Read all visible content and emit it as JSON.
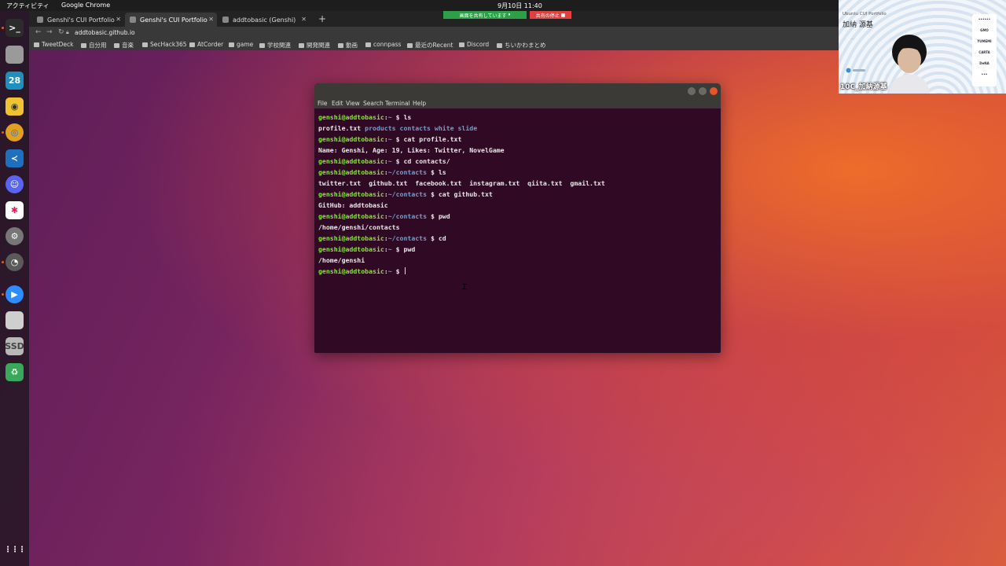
{
  "topbar": {
    "activities": "アクティビティ",
    "app_name": "Google Chrome",
    "clock": "9月10日 11:40"
  },
  "dock": {
    "items": [
      {
        "name": "terminal",
        "glyph": ">_",
        "color": "#2c2c2c",
        "fg": "#ffffff"
      },
      {
        "name": "files",
        "glyph": "",
        "color": "#9a9a9a",
        "fg": "#ffffff"
      },
      {
        "name": "calendar",
        "glyph": "28",
        "color": "#1e8fbf",
        "fg": "#ffffff"
      },
      {
        "name": "rhythmbox",
        "glyph": "◉",
        "color": "#f0c330",
        "fg": "#333333"
      },
      {
        "name": "chrome",
        "glyph": "◎",
        "color": "#e0a020",
        "fg": "#2a6fd6"
      },
      {
        "name": "vscode",
        "glyph": "≺",
        "color": "#1f6fbf",
        "fg": "#ffffff"
      },
      {
        "name": "discord",
        "glyph": "☺",
        "color": "#5865f2",
        "fg": "#ffffff"
      },
      {
        "name": "slack",
        "glyph": "✱",
        "color": "#ffffff",
        "fg": "#e01e5a"
      },
      {
        "name": "settings",
        "glyph": "⚙",
        "color": "#777777",
        "fg": "#ffffff"
      },
      {
        "name": "clock",
        "glyph": "◔",
        "color": "#5a5a5a",
        "fg": "#ffffff"
      },
      {
        "name": "zoom",
        "glyph": "▶",
        "color": "#2d8cff",
        "fg": "#ffffff"
      },
      {
        "name": "text-editor",
        "glyph": "",
        "color": "#cfcfcf",
        "fg": "#555555"
      },
      {
        "name": "ssd",
        "glyph": "SSD",
        "color": "#b8b8b8",
        "fg": "#444444"
      },
      {
        "name": "trash",
        "glyph": "♻",
        "color": "#3aa85a",
        "fg": "#ffffff"
      }
    ],
    "apps_grid": "⋮⋮⋮"
  },
  "browser": {
    "tabs": [
      {
        "title": "Genshi's CUI Portfolio",
        "active": false
      },
      {
        "title": "Genshi's CUI Portfolio",
        "active": true
      },
      {
        "title": "addtobasic (Genshi)",
        "active": false
      }
    ],
    "sharing": "画面を共有しています",
    "stop_sharing": "共有の停止",
    "url": "addtobasic.github.io",
    "bookmarks": [
      "TweetDeck",
      "自分用",
      "音楽",
      "SecHack365",
      "AtCorder",
      "game",
      "学校関連",
      "開発関連",
      "動画",
      "connpass",
      "最近のRecent",
      "Discord",
      "ちいかわまとめ"
    ]
  },
  "terminal": {
    "menu": [
      "File",
      "Edit",
      "View",
      "Search",
      "Terminal",
      "Help"
    ],
    "lines": [
      {
        "user": "genshi@addtobasic",
        "sep": ":",
        "path": "~",
        "cmd": " $ ls"
      },
      {
        "out": [
          {
            "t": "profile.txt ",
            "c": "plain"
          },
          {
            "t": "products ",
            "c": "dir"
          },
          {
            "t": "contacts ",
            "c": "dir"
          },
          {
            "t": "white ",
            "c": "dir"
          },
          {
            "t": "slide",
            "c": "dir"
          }
        ]
      },
      {
        "user": "genshi@addtobasic",
        "sep": ":",
        "path": "~",
        "cmd": " $ cat profile.txt"
      },
      {
        "out": [
          {
            "t": "Name: Genshi, Age: 19, Likes: Twitter, NovelGame",
            "c": "plain"
          }
        ]
      },
      {
        "user": "genshi@addtobasic",
        "sep": ":",
        "path": "~",
        "cmd": " $ cd contacts/"
      },
      {
        "user": "genshi@addtobasic",
        "sep": ":",
        "path": "~/contacts",
        "cmd": " $ ls"
      },
      {
        "out": [
          {
            "t": "twitter.txt  github.txt  facebook.txt  instagram.txt  qiita.txt  gmail.txt",
            "c": "plain"
          }
        ]
      },
      {
        "user": "genshi@addtobasic",
        "sep": ":",
        "path": "~/contacts",
        "cmd": " $ cat github.txt"
      },
      {
        "out": [
          {
            "t": "GitHub: addtobasic",
            "c": "plain"
          }
        ]
      },
      {
        "user": "genshi@addtobasic",
        "sep": ":",
        "path": "~/contacts",
        "cmd": " $ pwd"
      },
      {
        "out": [
          {
            "t": "/home/genshi/contacts",
            "c": "plain"
          }
        ]
      },
      {
        "user": "genshi@addtobasic",
        "sep": ":",
        "path": "~/contacts",
        "cmd": " $ cd"
      },
      {
        "user": "genshi@addtobasic",
        "sep": ":",
        "path": "~",
        "cmd": " $ pwd"
      },
      {
        "out": [
          {
            "t": "/home/genshi",
            "c": "plain"
          }
        ]
      },
      {
        "user": "genshi@addtobasic",
        "sep": ":",
        "path": "~",
        "cmd": " $ ",
        "cursor": true
      }
    ]
  },
  "webcam": {
    "subtitle": "Ubuntu CUI Portfolio",
    "name": "加納 源基",
    "note": "…",
    "participant": "10C_加納源基",
    "sponsors": [
      "••••••",
      "GMO",
      "YUMEMI",
      "CARTA",
      "DeNA",
      "•••"
    ]
  }
}
